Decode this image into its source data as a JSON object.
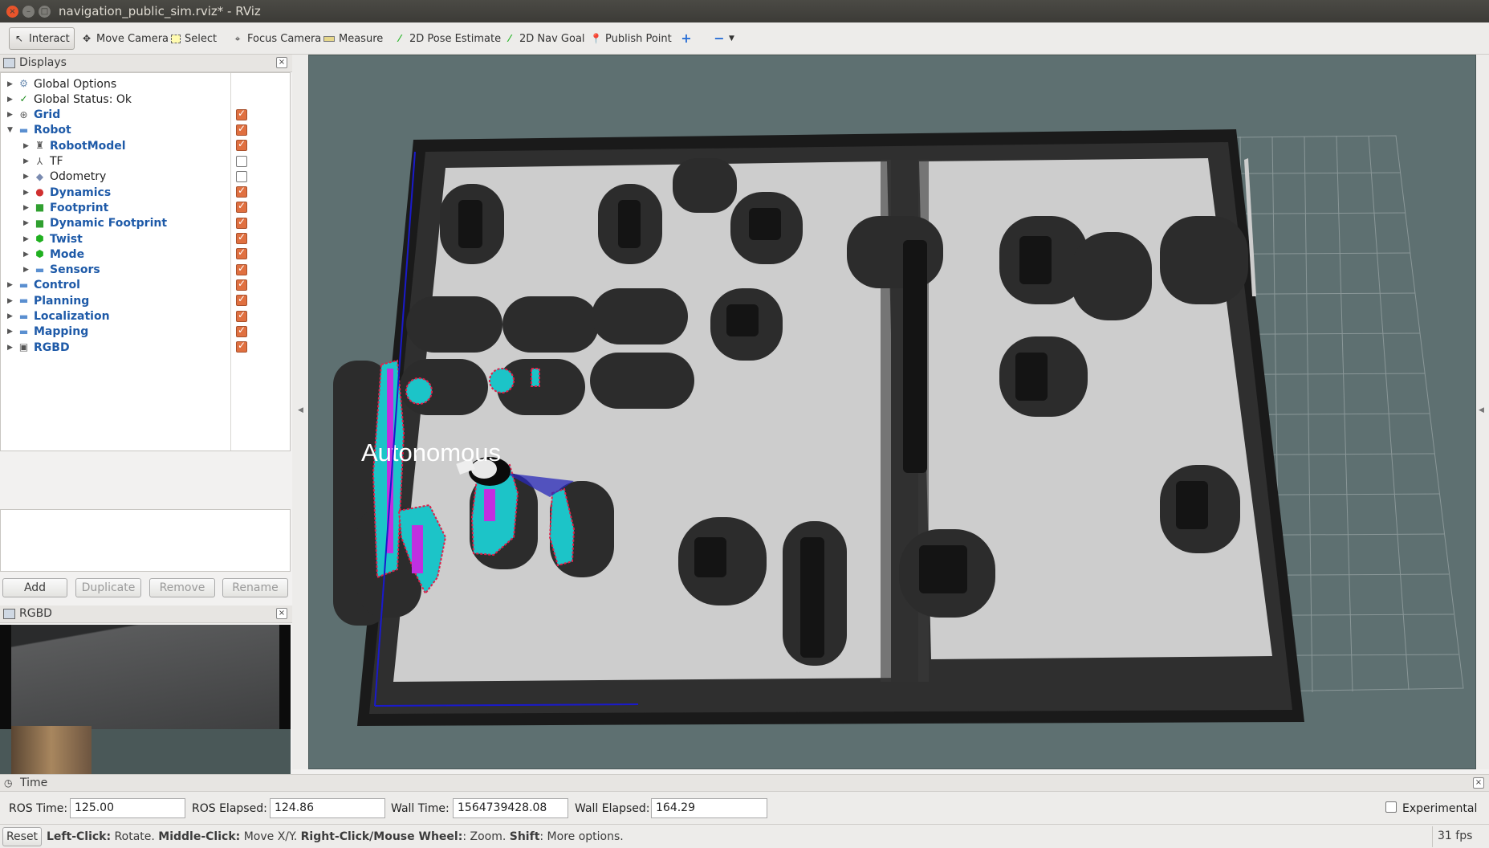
{
  "window": {
    "title": "navigation_public_sim.rviz* - RViz"
  },
  "toolbar": {
    "tools": [
      {
        "label": "Interact",
        "icon": "interact-icon"
      },
      {
        "label": "Move Camera",
        "icon": "move-camera-icon"
      },
      {
        "label": "Select",
        "icon": "select-icon"
      },
      {
        "label": "Focus Camera",
        "icon": "focus-camera-icon"
      },
      {
        "label": "Measure",
        "icon": "measure-icon"
      },
      {
        "label": "2D Pose Estimate",
        "icon": "pose-estimate-icon"
      },
      {
        "label": "2D Nav Goal",
        "icon": "nav-goal-icon"
      },
      {
        "label": "Publish Point",
        "icon": "publish-point-icon"
      }
    ]
  },
  "displays": {
    "title": "Displays",
    "items": [
      {
        "label": "Global Options",
        "checked": null
      },
      {
        "label": "Global Status: Ok",
        "checked": null
      },
      {
        "label": "Grid",
        "checked": true
      },
      {
        "label": "Robot",
        "checked": true
      },
      {
        "label": "RobotModel",
        "checked": true
      },
      {
        "label": "TF",
        "checked": false
      },
      {
        "label": "Odometry",
        "checked": false
      },
      {
        "label": "Dynamics",
        "checked": true
      },
      {
        "label": "Footprint",
        "checked": true
      },
      {
        "label": "Dynamic Footprint",
        "checked": true
      },
      {
        "label": "Twist",
        "checked": true
      },
      {
        "label": "Mode",
        "checked": true
      },
      {
        "label": "Sensors",
        "checked": true
      },
      {
        "label": "Control",
        "checked": true
      },
      {
        "label": "Planning",
        "checked": true
      },
      {
        "label": "Localization",
        "checked": true
      },
      {
        "label": "Mapping",
        "checked": true
      },
      {
        "label": "RGBD",
        "checked": true
      }
    ],
    "buttons": {
      "add": "Add",
      "duplicate": "Duplicate",
      "remove": "Remove",
      "rename": "Rename"
    }
  },
  "rgbd_panel": {
    "title": "RGBD"
  },
  "viewport": {
    "overlay_text": "Autonomous"
  },
  "time_panel": {
    "title": "Time",
    "ros_time_label": "ROS Time:",
    "ros_time": "125.00",
    "ros_elapsed_label": "ROS Elapsed:",
    "ros_elapsed": "124.86",
    "wall_time_label": "Wall Time:",
    "wall_time": "1564739428.08",
    "wall_elapsed_label": "Wall Elapsed:",
    "wall_elapsed": "164.29",
    "experimental_label": "Experimental"
  },
  "status_bar": {
    "reset": "Reset",
    "left_click": "Left-Click:",
    "left_click_desc": " Rotate. ",
    "middle_click": "Middle-Click:",
    "middle_click_desc": " Move X/Y. ",
    "right_click": "Right-Click/Mouse Wheel:",
    "right_click_desc": ": Zoom. ",
    "shift": "Shift",
    "shift_desc": ": More options.",
    "fps": "31 fps"
  }
}
